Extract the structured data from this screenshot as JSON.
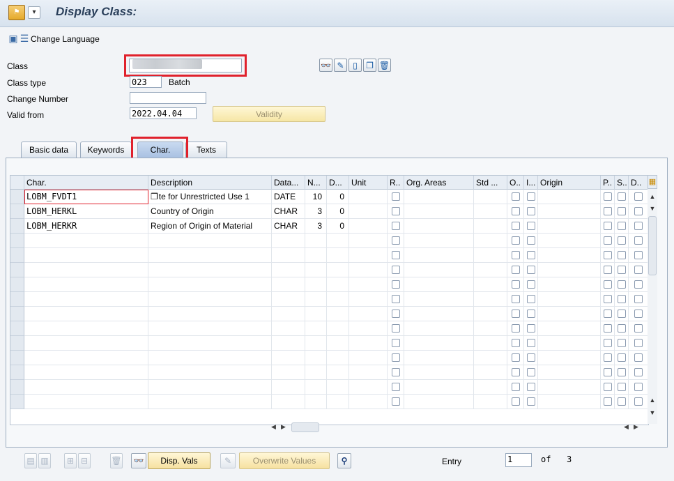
{
  "window": {
    "title": "Display Class:"
  },
  "toolbar": {
    "change_language": "Change Language"
  },
  "header": {
    "class_label": "Class",
    "class_value": "",
    "class_type_label": "Class type",
    "class_type_value": "023",
    "class_type_desc": "Batch",
    "change_number_label": "Change Number",
    "change_number_value": "",
    "valid_from_label": "Valid from",
    "valid_from_value": "2022.04.04",
    "validity_button": "Validity"
  },
  "tabs": [
    "Basic data",
    "Keywords",
    "Char.",
    "Texts"
  ],
  "table": {
    "headers": {
      "char": "Char.",
      "description": "Description",
      "datatype": "Data...",
      "n": "N...",
      "d": "D...",
      "unit": "Unit",
      "r": "R..",
      "org_areas": "Org. Areas",
      "std": "Std ...",
      "o": "O..",
      "i": "I...",
      "origin": "Origin",
      "p": "P..",
      "s": "S..",
      "dd": "D.."
    },
    "rows": [
      {
        "char": "LOBM_FVDT1",
        "description": "te for Unrestricted Use 1",
        "datatype": "DATE",
        "n": "10",
        "d": "0"
      },
      {
        "char": "LOBM_HERKL",
        "description": "Country of Origin",
        "datatype": "CHAR",
        "n": "3",
        "d": "0"
      },
      {
        "char": "LOBM_HERKR",
        "description": "Region of Origin of Material",
        "datatype": "CHAR",
        "n": "3",
        "d": "0"
      }
    ],
    "empty_rows": 12
  },
  "footer": {
    "disp_vals": "Disp. Vals",
    "overwrite_values": "Overwrite Values",
    "entry_label": "Entry",
    "entry_value": "1",
    "of_label": "of",
    "total": "3"
  },
  "colors": {
    "accent_red": "#e0212c",
    "button_yellow": "#f6e1a0",
    "header_bg": "#e7edf4"
  }
}
